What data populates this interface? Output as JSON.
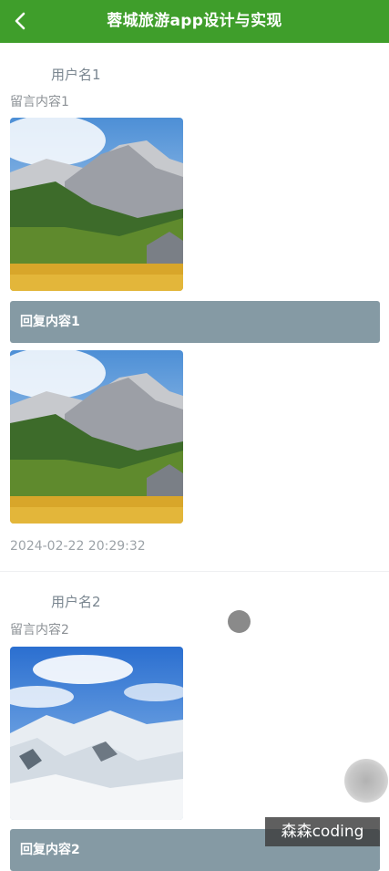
{
  "header": {
    "title": "蓉城旅游app设计与实现",
    "back_icon": "chevron-left-icon",
    "color": "#3f9e2b"
  },
  "posts": [
    {
      "username": "用户名1",
      "message": "留言内容1",
      "reply": "回复内容1",
      "time": "2024-02-22 20:29:32"
    },
    {
      "username": "用户名2",
      "message": "留言内容2",
      "reply": "回复内容2"
    }
  ],
  "colors": {
    "reply_bg": "#859aa4",
    "username": "#7a8690"
  },
  "watermark": "森森coding"
}
